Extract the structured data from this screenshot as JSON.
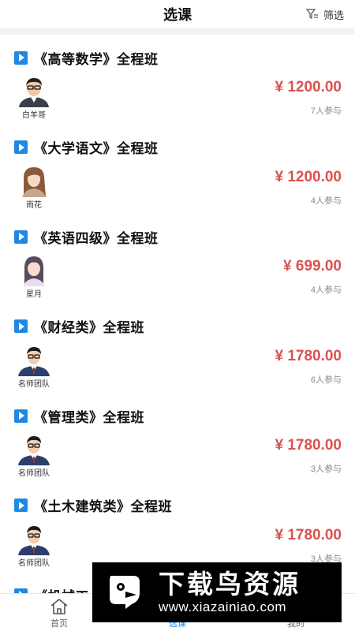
{
  "header": {
    "title": "选课",
    "filter_label": "筛选"
  },
  "courses": [
    {
      "name": "《高等数学》全程班",
      "teacher": "白羊哥",
      "price": "¥ 1200.00",
      "count": "7人参与"
    },
    {
      "name": "《大学语文》全程班",
      "teacher": "雨花",
      "price": "¥ 1200.00",
      "count": "4人参与"
    },
    {
      "name": "《英语四级》全程班",
      "teacher": "星月",
      "price": "¥ 699.00",
      "count": "4人参与"
    },
    {
      "name": "《财经类》全程班",
      "teacher": "名师团队",
      "price": "¥ 1780.00",
      "count": "6人参与"
    },
    {
      "name": "《管理类》全程班",
      "teacher": "名师团队",
      "price": "¥ 1780.00",
      "count": "3人参与"
    },
    {
      "name": "《土木建筑类》全程班",
      "teacher": "名师团队",
      "price": "¥ 1780.00",
      "count": "3人参与"
    },
    {
      "name": "《机械工...",
      "teacher": "",
      "price": "",
      "count": ""
    }
  ],
  "tabbar": {
    "home": "首页",
    "courses": "选课",
    "mine": "我的"
  },
  "colors": {
    "accent": "#1e88e5",
    "price": "#d9534f"
  },
  "watermark": {
    "main": "下载鸟资源",
    "url": "www.xiazainiao.com"
  }
}
